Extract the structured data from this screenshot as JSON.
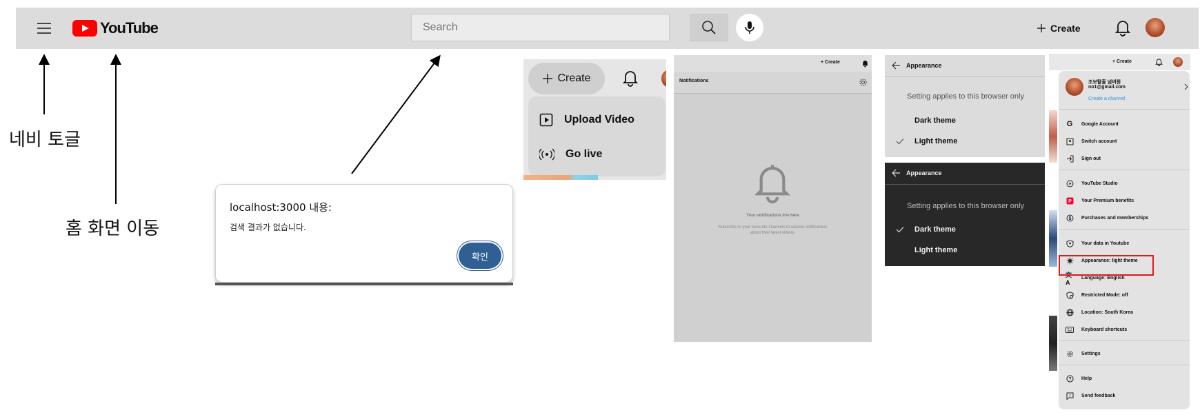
{
  "header": {
    "logo_text": "YouTube",
    "search_placeholder": "Search",
    "create_label": "Create"
  },
  "annotations": {
    "nav_toggle": "네비 토글",
    "go_home": "홈 화면 이동"
  },
  "dialog": {
    "title": "localhost:3000 내용:",
    "message": "검색 결과가 없습니다.",
    "ok_label": "확인"
  },
  "create_menu": {
    "button_label": "Create",
    "items": [
      {
        "label": "Upload Video",
        "icon": "upload-video-icon"
      },
      {
        "label": "Go live",
        "icon": "go-live-icon"
      }
    ]
  },
  "notifications": {
    "create_label": "Create",
    "title": "Notifications",
    "empty_title": "Your notifications live here",
    "empty_body": "Subscribe to your favourite channels to receive notifications about their latest videos."
  },
  "appearance_light": {
    "title": "Appearance",
    "note": "Setting applies to this browser only",
    "dark_label": "Dark theme",
    "light_label": "Light theme",
    "selected": "light"
  },
  "appearance_dark": {
    "title": "Appearance",
    "note": "Setting applies to this browser only",
    "dark_label": "Dark theme",
    "light_label": "Light theme",
    "selected": "dark"
  },
  "account": {
    "create_label": "Create",
    "name": "조보탈출 넘버원",
    "email": "no1@gmail.com",
    "create_channel": "Create a channel",
    "items": [
      {
        "label": "Google Account",
        "icon": "google-icon"
      },
      {
        "label": "Switch account",
        "icon": "switch-account-icon"
      },
      {
        "label": "Sign out",
        "icon": "sign-out-icon"
      },
      {
        "label": "YouTube Studio",
        "icon": "studio-icon"
      },
      {
        "label": "Your Premium benefits",
        "icon": "premium-icon"
      },
      {
        "label": "Purchases and memberships",
        "icon": "dollar-icon"
      },
      {
        "label": "Your data in Youtube",
        "icon": "shield-icon"
      },
      {
        "label": "Appearance: light theme",
        "icon": "appearance-icon"
      },
      {
        "label": "Language: English",
        "icon": "language-icon"
      },
      {
        "label": "Restricted Mode: off",
        "icon": "restricted-icon"
      },
      {
        "label": "Location: South Korea",
        "icon": "globe-icon"
      },
      {
        "label": "Keyboard shortcuts",
        "icon": "keyboard-icon"
      },
      {
        "label": "Settings",
        "icon": "gear-icon"
      },
      {
        "label": "Help",
        "icon": "help-icon"
      },
      {
        "label": "Send feedback",
        "icon": "feedback-icon"
      }
    ]
  },
  "colors": {
    "youtube_red": "#ff0000",
    "highlight_red": "#e0191b",
    "dialog_button": "#2f5f93",
    "link_blue": "#3b8edb"
  }
}
